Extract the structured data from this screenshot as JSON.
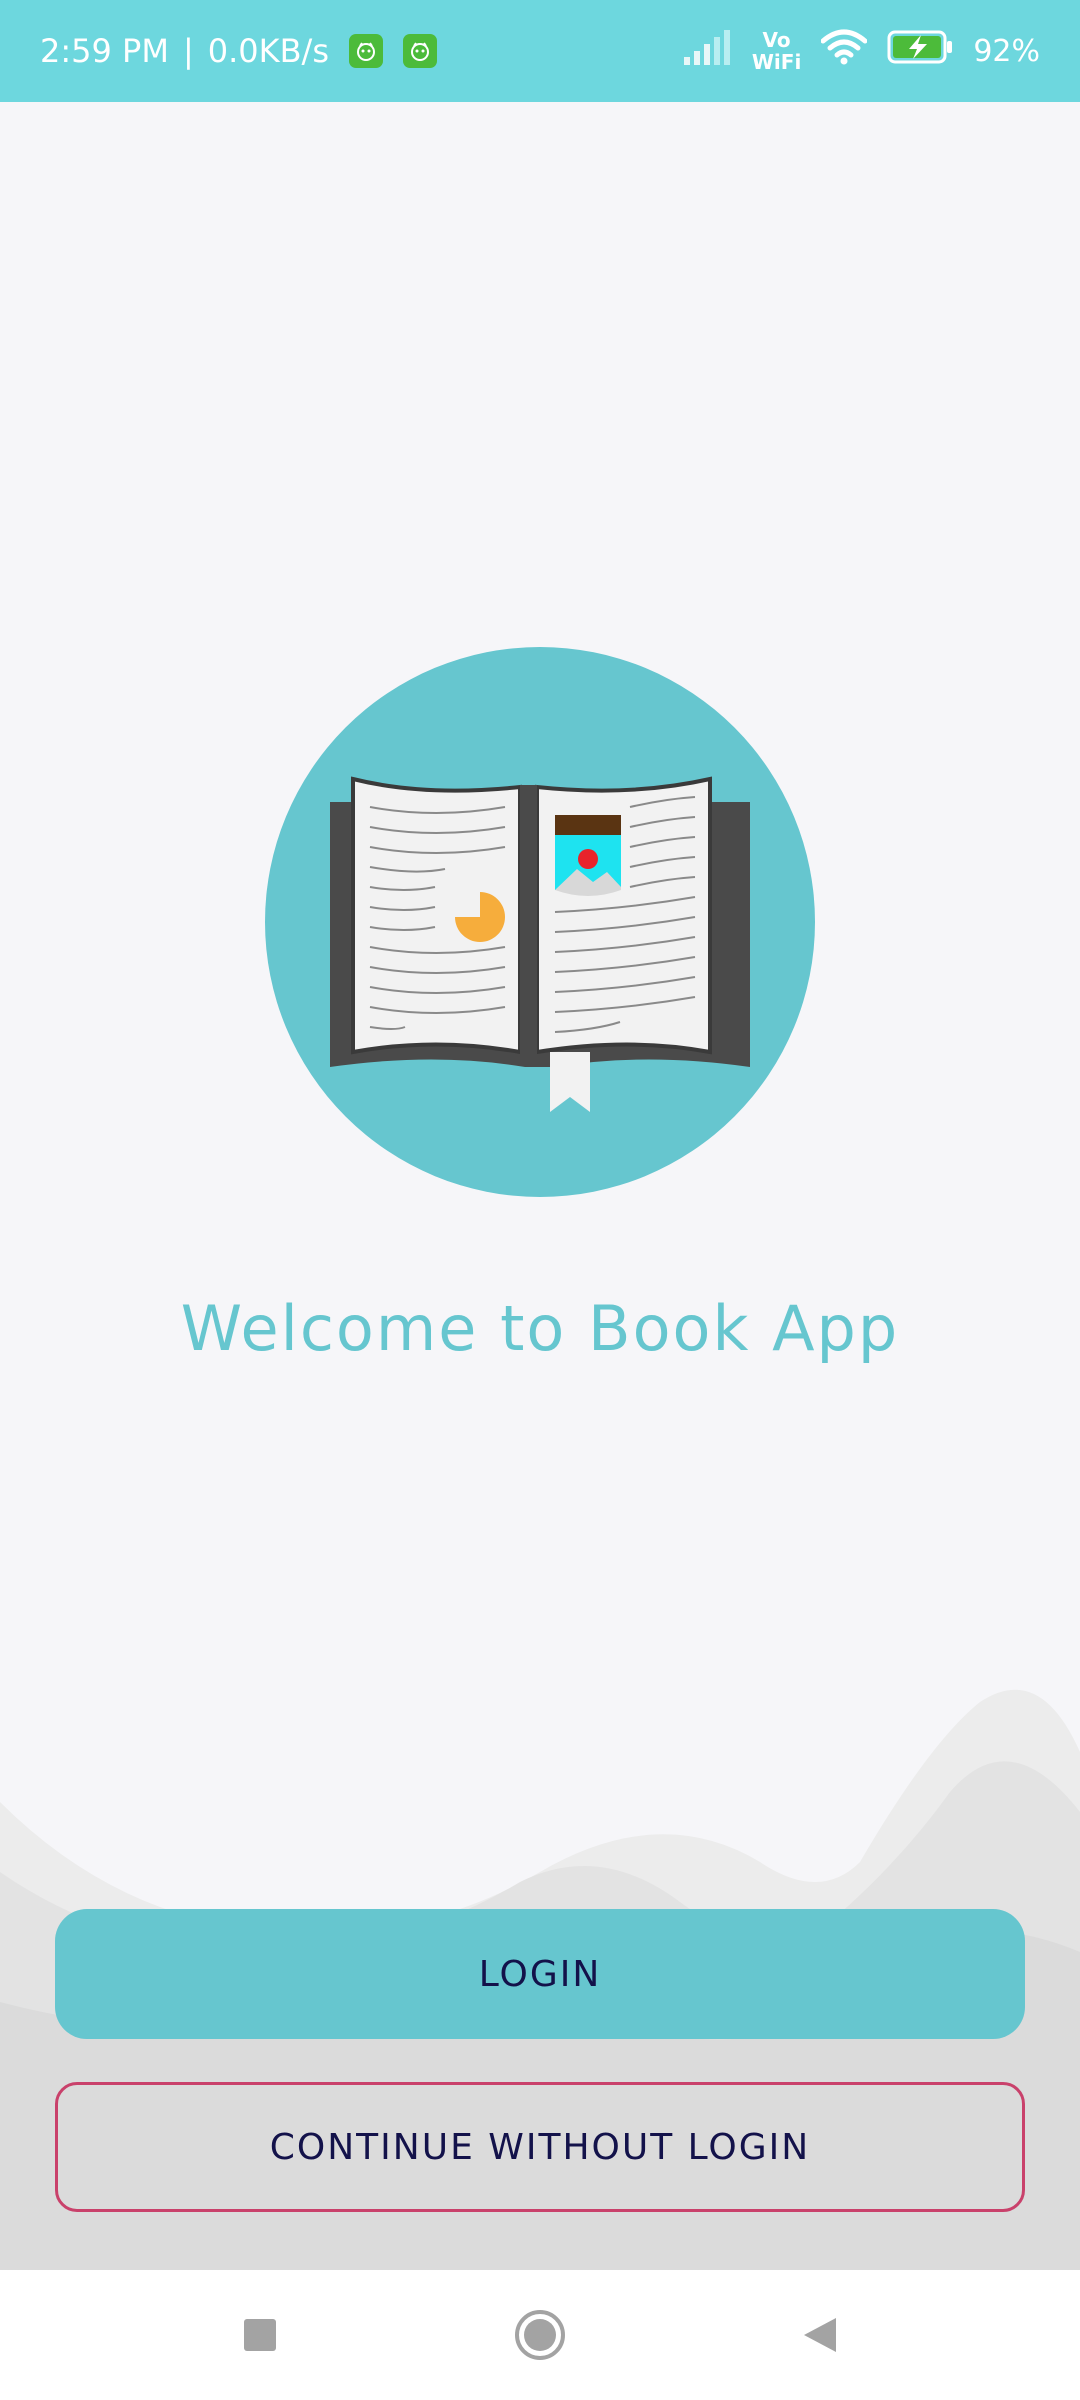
{
  "status_bar": {
    "time": "2:59 PM",
    "separator": "|",
    "network_speed": "0.0KB/s",
    "vo_label": "Vo",
    "wifi_label": "WiFi",
    "battery_percent": "92%",
    "icons": [
      "app-notification-icon",
      "app-notification-icon",
      "signal-icon",
      "vowifi-icon",
      "wifi-icon",
      "battery-charging-icon"
    ]
  },
  "hero": {
    "icon": "open-book-icon",
    "colors": {
      "circle": "#66c6cf",
      "book_cover": "#4a4a4a",
      "page": "#f2f2f2",
      "pie": "#f6ad3c",
      "picture_sky": "#1ee3f0",
      "picture_sun": "#e8232b"
    }
  },
  "welcome_text": "Welcome to Book App",
  "buttons": {
    "login_label": "LOGIN",
    "guest_label": "CONTINUE WITHOUT LOGIN"
  },
  "colors": {
    "accent": "#66c6cf",
    "status_bar": "#6dd7de",
    "button_text": "#13124a",
    "outline_button": "#c9416b",
    "background": "#f6f6f9"
  },
  "nav": {
    "icons": [
      "recent-apps-icon",
      "home-icon",
      "back-icon"
    ]
  }
}
